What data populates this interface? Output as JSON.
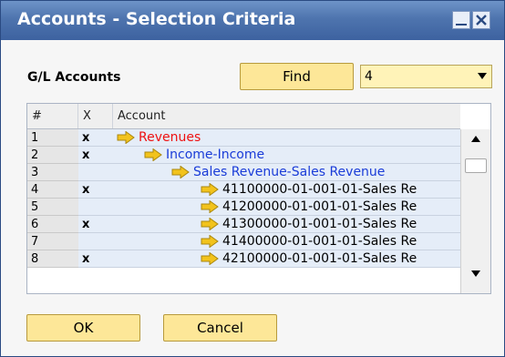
{
  "window": {
    "title": "Accounts - Selection Criteria"
  },
  "criteria": {
    "label": "G/L Accounts",
    "find_label": "Find",
    "dropdown_value": "4"
  },
  "table": {
    "columns": [
      "#",
      "X",
      "Account"
    ],
    "rows": [
      {
        "num": "1",
        "x": "x",
        "account": "Revenues",
        "level": 1
      },
      {
        "num": "2",
        "x": "x",
        "account": "Income-Income",
        "level": 2
      },
      {
        "num": "3",
        "x": "",
        "account": "Sales Revenue-Sales Revenue",
        "level": 3
      },
      {
        "num": "4",
        "x": "x",
        "account": "41100000-01-001-01-Sales Re",
        "level": 4
      },
      {
        "num": "5",
        "x": "",
        "account": "41200000-01-001-01-Sales Re",
        "level": 4
      },
      {
        "num": "6",
        "x": "x",
        "account": "41300000-01-001-01-Sales Re",
        "level": 4
      },
      {
        "num": "7",
        "x": "",
        "account": "41400000-01-001-01-Sales Re",
        "level": 4
      },
      {
        "num": "8",
        "x": "x",
        "account": "42100000-01-001-01-Sales Re",
        "level": 4
      }
    ]
  },
  "buttons": {
    "ok": "OK",
    "cancel": "Cancel"
  },
  "icons": {
    "minimize": "minimize-icon",
    "close": "close-icon",
    "tree_arrow": "arrow-right-icon"
  },
  "colors": {
    "titlebar": "#4e74ae",
    "button": "#fde798",
    "level1": "#ee1111",
    "level2": "#1a3cd8"
  }
}
